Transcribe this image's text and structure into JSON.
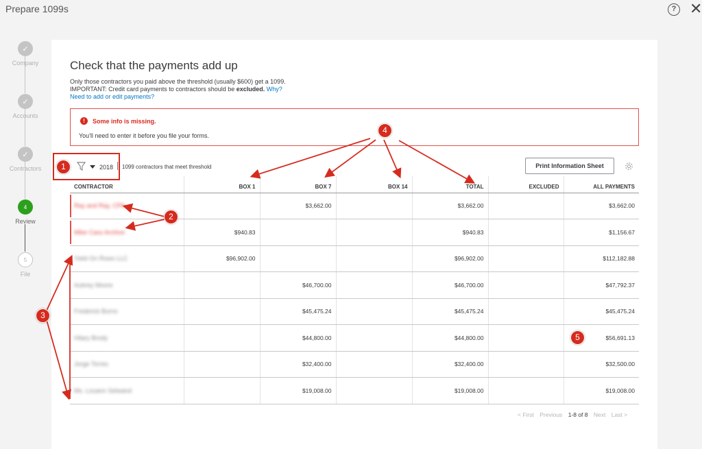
{
  "app_title": "Prepare 1099s",
  "help_label": "?",
  "close_label": "✕",
  "steps": [
    {
      "label": "Company",
      "marker": "✓"
    },
    {
      "label": "Accounts",
      "marker": "✓"
    },
    {
      "label": "Contractors",
      "marker": "✓"
    },
    {
      "label": "Review",
      "marker": "4"
    },
    {
      "label": "File",
      "marker": "5"
    }
  ],
  "main": {
    "heading": "Check that the payments add up",
    "desc_line1": "Only those contractors you paid above the threshold (usually $600) get a 1099.",
    "desc_line2_prefix": "IMPORTANT: Credit card payments to contractors should be ",
    "desc_line2_bold": "excluded.",
    "desc_line2_link": "Why?",
    "edit_link": "Need to add or edit payments?",
    "alert_icon": "!",
    "alert_title": "Some info is missing.",
    "alert_text": "You'll need to enter it before you file your forms.",
    "year": "2018",
    "threshold_text": "1099 contractors that meet threshold",
    "print_button": "Print Information Sheet"
  },
  "table": {
    "headers": [
      "CONTRACTOR",
      "BOX 1",
      "BOX 7",
      "BOX 14",
      "TOTAL",
      "EXCLUDED",
      "ALL PAYMENTS"
    ],
    "rows": [
      {
        "contractor": "Ray and Ray, CPA",
        "box1": "",
        "box7": "$3,662.00",
        "box14": "",
        "total": "$3,662.00",
        "excluded": "",
        "all": "$3,662.00"
      },
      {
        "contractor": "Mike Cass Archive",
        "box1": "$940.83",
        "box7": "",
        "box14": "",
        "total": "$940.83",
        "excluded": "",
        "all": "$1,156.67"
      },
      {
        "contractor": "Yield On Rows LLC",
        "box1": "$96,902.00",
        "box7": "",
        "box14": "",
        "total": "$96,902.00",
        "excluded": "",
        "all": "$112,182.88"
      },
      {
        "contractor": "Aubrey Moore",
        "box1": "",
        "box7": "$46,700.00",
        "box14": "",
        "total": "$46,700.00",
        "excluded": "",
        "all": "$47,792.37"
      },
      {
        "contractor": "Frederick Burns",
        "box1": "",
        "box7": "$45,475.24",
        "box14": "",
        "total": "$45,475.24",
        "excluded": "",
        "all": "$45,475.24"
      },
      {
        "contractor": "Hilary Brody",
        "box1": "",
        "box7": "$44,800.00",
        "box14": "",
        "total": "$44,800.00",
        "excluded": "",
        "all": "$56,691.13"
      },
      {
        "contractor": "Jorge Torres",
        "box1": "",
        "box7": "$32,400.00",
        "box14": "",
        "total": "$32,400.00",
        "excluded": "",
        "all": "$32,500.00"
      },
      {
        "contractor": "Ms. Louann Selwand",
        "box1": "",
        "box7": "$19,008.00",
        "box14": "",
        "total": "$19,008.00",
        "excluded": "",
        "all": "$19,008.00"
      }
    ]
  },
  "pager": {
    "first": "< First",
    "previous": "Previous",
    "range": "1-8 of 8",
    "next": "Next",
    "last": "Last >"
  },
  "annotations": [
    "1",
    "2",
    "3",
    "4",
    "5"
  ],
  "colors": {
    "accent_red": "#d52b1e",
    "green": "#2ca01c",
    "link": "#0077c5"
  }
}
